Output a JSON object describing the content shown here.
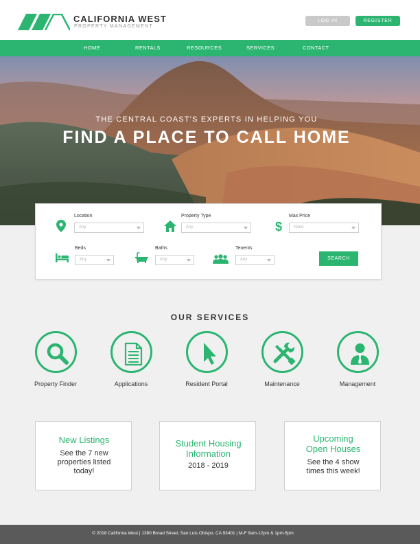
{
  "brand": {
    "name": "CALIFORNIA WEST",
    "tagline": "PROPERTY MANAGEMENT",
    "accent_color": "#2bb570"
  },
  "header": {
    "login_label": "LOG IN",
    "register_label": "REGISTER"
  },
  "nav": {
    "items": [
      "HOME",
      "RENTALS",
      "RESOURCES",
      "SERVICES",
      "CONTACT"
    ]
  },
  "hero": {
    "kicker": "THE CENTRAL COAST'S EXPERTS IN HELPING YOU",
    "title": "FIND A PLACE TO CALL HOME"
  },
  "search": {
    "location": {
      "label": "Location",
      "value": "Any",
      "icon": "map-pin-icon"
    },
    "property_type": {
      "label": "Property Type",
      "value": "Any",
      "icon": "house-icon"
    },
    "max_price": {
      "label": "Max Price",
      "value": "None",
      "icon": "dollar-icon"
    },
    "beds": {
      "label": "Beds",
      "value": "Any",
      "icon": "bed-icon"
    },
    "baths": {
      "label": "Baths",
      "value": "Any",
      "icon": "bathtub-icon"
    },
    "tenents": {
      "label": "Tenents",
      "value": "Any",
      "icon": "people-icon"
    },
    "button_label": "SEARCH"
  },
  "services": {
    "title": "OUR SERVICES",
    "items": [
      {
        "label": "Property Finder",
        "icon": "magnifier-icon"
      },
      {
        "label": "Applications",
        "icon": "document-icon"
      },
      {
        "label": "Resident Portal",
        "icon": "cursor-icon"
      },
      {
        "label": "Maintenance",
        "icon": "tools-icon"
      },
      {
        "label": "Management",
        "icon": "manager-icon"
      }
    ]
  },
  "cards": [
    {
      "title_lines": [
        "New Listings"
      ],
      "body_lines": [
        "See the 7 new",
        "properties listed",
        "today!"
      ]
    },
    {
      "title_lines": [
        "Student Housing",
        "Information"
      ],
      "body_lines": [
        "2018 - 2019"
      ]
    },
    {
      "title_lines": [
        "Upcoming",
        "Open Houses"
      ],
      "body_lines": [
        "See the 4 show",
        "times this week!"
      ]
    }
  ],
  "footer": {
    "text": "© 2018 California West  |  1380 Broad Street, San Luis Obispo, CA 93401  |  M-F 9am-12pm & 1pm-5pm"
  }
}
